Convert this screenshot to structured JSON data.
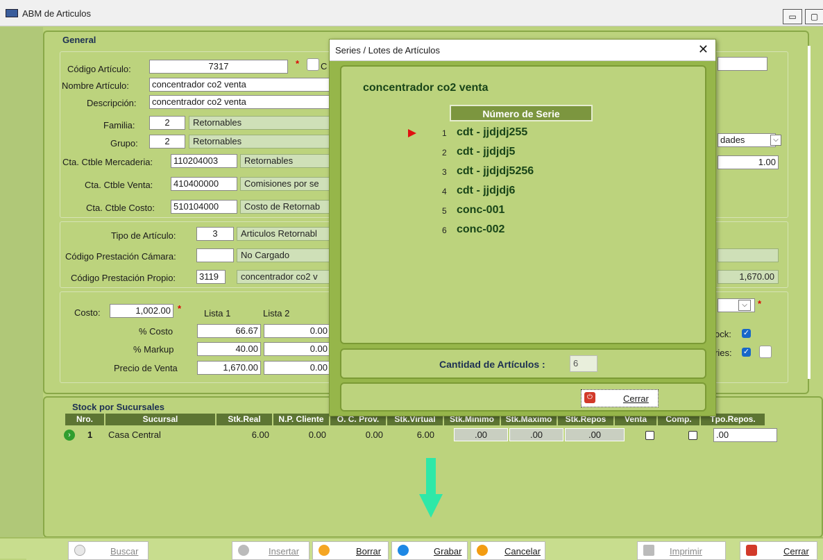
{
  "window": {
    "title": "ABM de Articulos",
    "minimize": "▭",
    "restore": "▢"
  },
  "general": {
    "title": "General",
    "codigo_label": "Código Artículo:",
    "codigo_value": "7317",
    "codigo_after": "C",
    "nombre_label": "Nombre Artículo:",
    "nombre_value": "concentrador co2 venta",
    "descripcion_label": "Descripción:",
    "descripcion_value": "concentrador co2 venta",
    "familia_label": "Familia:",
    "familia_code": "2",
    "familia_value": "Retornables",
    "grupo_label": "Grupo:",
    "grupo_code": "2",
    "grupo_value": "Retornables",
    "cta_merc_label": "Cta. Ctble Mercaderia:",
    "cta_merc_code": "110204003",
    "cta_merc_value": "Retornables",
    "cta_venta_label": "Cta. Ctble Venta:",
    "cta_venta_code": "410400000",
    "cta_venta_value": "Comisiones por se",
    "cta_costo_label": "Cta. Ctble Costo:",
    "cta_costo_code": "510104000",
    "cta_costo_value": "Costo de Retornab",
    "right_unidades": "dades",
    "right_factor": "1.00"
  },
  "tipo": {
    "tipo_label": "Tipo de Artículo:",
    "tipo_code": "3",
    "tipo_value": "Articulos Retornabl",
    "camara_label": "Código Prestación Cámara:",
    "camara_code": "",
    "camara_value": "No Cargado",
    "propio_label": "Código Prestación Propio:",
    "propio_code": "3119",
    "propio_value": "concentrador co2 v",
    "right_precio": "1,670.00"
  },
  "precios": {
    "costo_label": "Costo:",
    "costo_value": "1,002.00",
    "lista1": "Lista 1",
    "lista2": "Lista 2",
    "pct_costo_label": "% Costo",
    "pct_costo_l1": "66.67",
    "pct_costo_l2": "0.00",
    "markup_label": "% Markup",
    "markup_l1": "40.00",
    "markup_l2": "0.00",
    "precio_label": "Precio de Venta",
    "precio_l1": "1,670.00",
    "precio_l2": "0.00",
    "right_stock": "ock:",
    "right_series": "ries:"
  },
  "stock": {
    "title": "Stock por Sucursales",
    "headers": [
      "Nro.",
      "Sucursal",
      "Stk.Real",
      "N.P. Cliente",
      "O. C. Prov.",
      "Stk.Virtual",
      "Stk.Minimo",
      "Stk.Maximo",
      "Stk.Repos",
      "Venta",
      "Comp.",
      "Tpo.Repos."
    ],
    "row": {
      "nro": "1",
      "sucursal": "Casa Central",
      "real": "6.00",
      "np": "0.00",
      "oc": "0.00",
      "virtual": "6.00",
      "min": ".00",
      "max": ".00",
      "repos": ".00",
      "tpo": ".00"
    }
  },
  "dialog": {
    "title": "Series / Lotes de Artículos",
    "close": "✕",
    "article": "concentrador co2 venta",
    "column_header": "Número de Serie",
    "series": [
      {
        "n": "1",
        "value": "cdt - jjdjdj255"
      },
      {
        "n": "2",
        "value": "cdt - jjdjdj5"
      },
      {
        "n": "3",
        "value": "cdt - jjdjdj5256"
      },
      {
        "n": "4",
        "value": "cdt - jjdjdj6"
      },
      {
        "n": "5",
        "value": "conc-001"
      },
      {
        "n": "6",
        "value": "conc-002"
      }
    ],
    "cantidad_label": "Cantidad de Artículos :",
    "cantidad_value": "6",
    "cerrar": "Cerrar"
  },
  "toolbar": {
    "buscar": "Buscar",
    "insertar": "Insertar",
    "borrar": "Borrar",
    "grabar": "Grabar",
    "cancelar": "Cancelar",
    "imprimir": "Imprimir",
    "cerrar": "Cerrar"
  },
  "colors": {
    "bg": "#bcd37d",
    "header": "#5d7533",
    "accent_arrow": "#2ee8a8",
    "dialog": "#96b64a"
  }
}
